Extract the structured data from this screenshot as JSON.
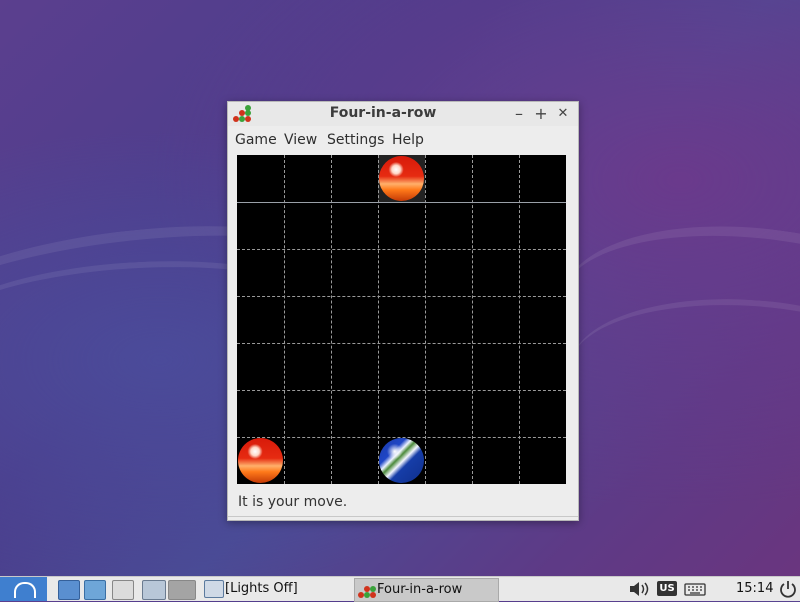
{
  "window": {
    "title": "Four-in-a-row",
    "menu": [
      "Game",
      "View",
      "Settings",
      "Help"
    ],
    "status_text": "It is your move.",
    "controls": {
      "minimize": "–",
      "maximize": "+",
      "close": "✕"
    }
  },
  "board": {
    "columns": 7,
    "rows": 7,
    "pieces": [
      {
        "color": "red",
        "row": 0,
        "col": 3
      },
      {
        "color": "red",
        "row": 6,
        "col": 0
      },
      {
        "color": "blue",
        "row": 6,
        "col": 3
      }
    ]
  },
  "taskbar": {
    "tasks": [
      {
        "label": "[Lights Off]",
        "active": false
      },
      {
        "label": "Four-in-a-row",
        "active": true
      }
    ],
    "keyboard_layout": "US",
    "clock": "15:14"
  },
  "colors": {
    "board_bg": "#000000",
    "red_piece": "#e62b11",
    "blue_piece": "#1f46c7",
    "start_button": "#3f7fcf"
  }
}
